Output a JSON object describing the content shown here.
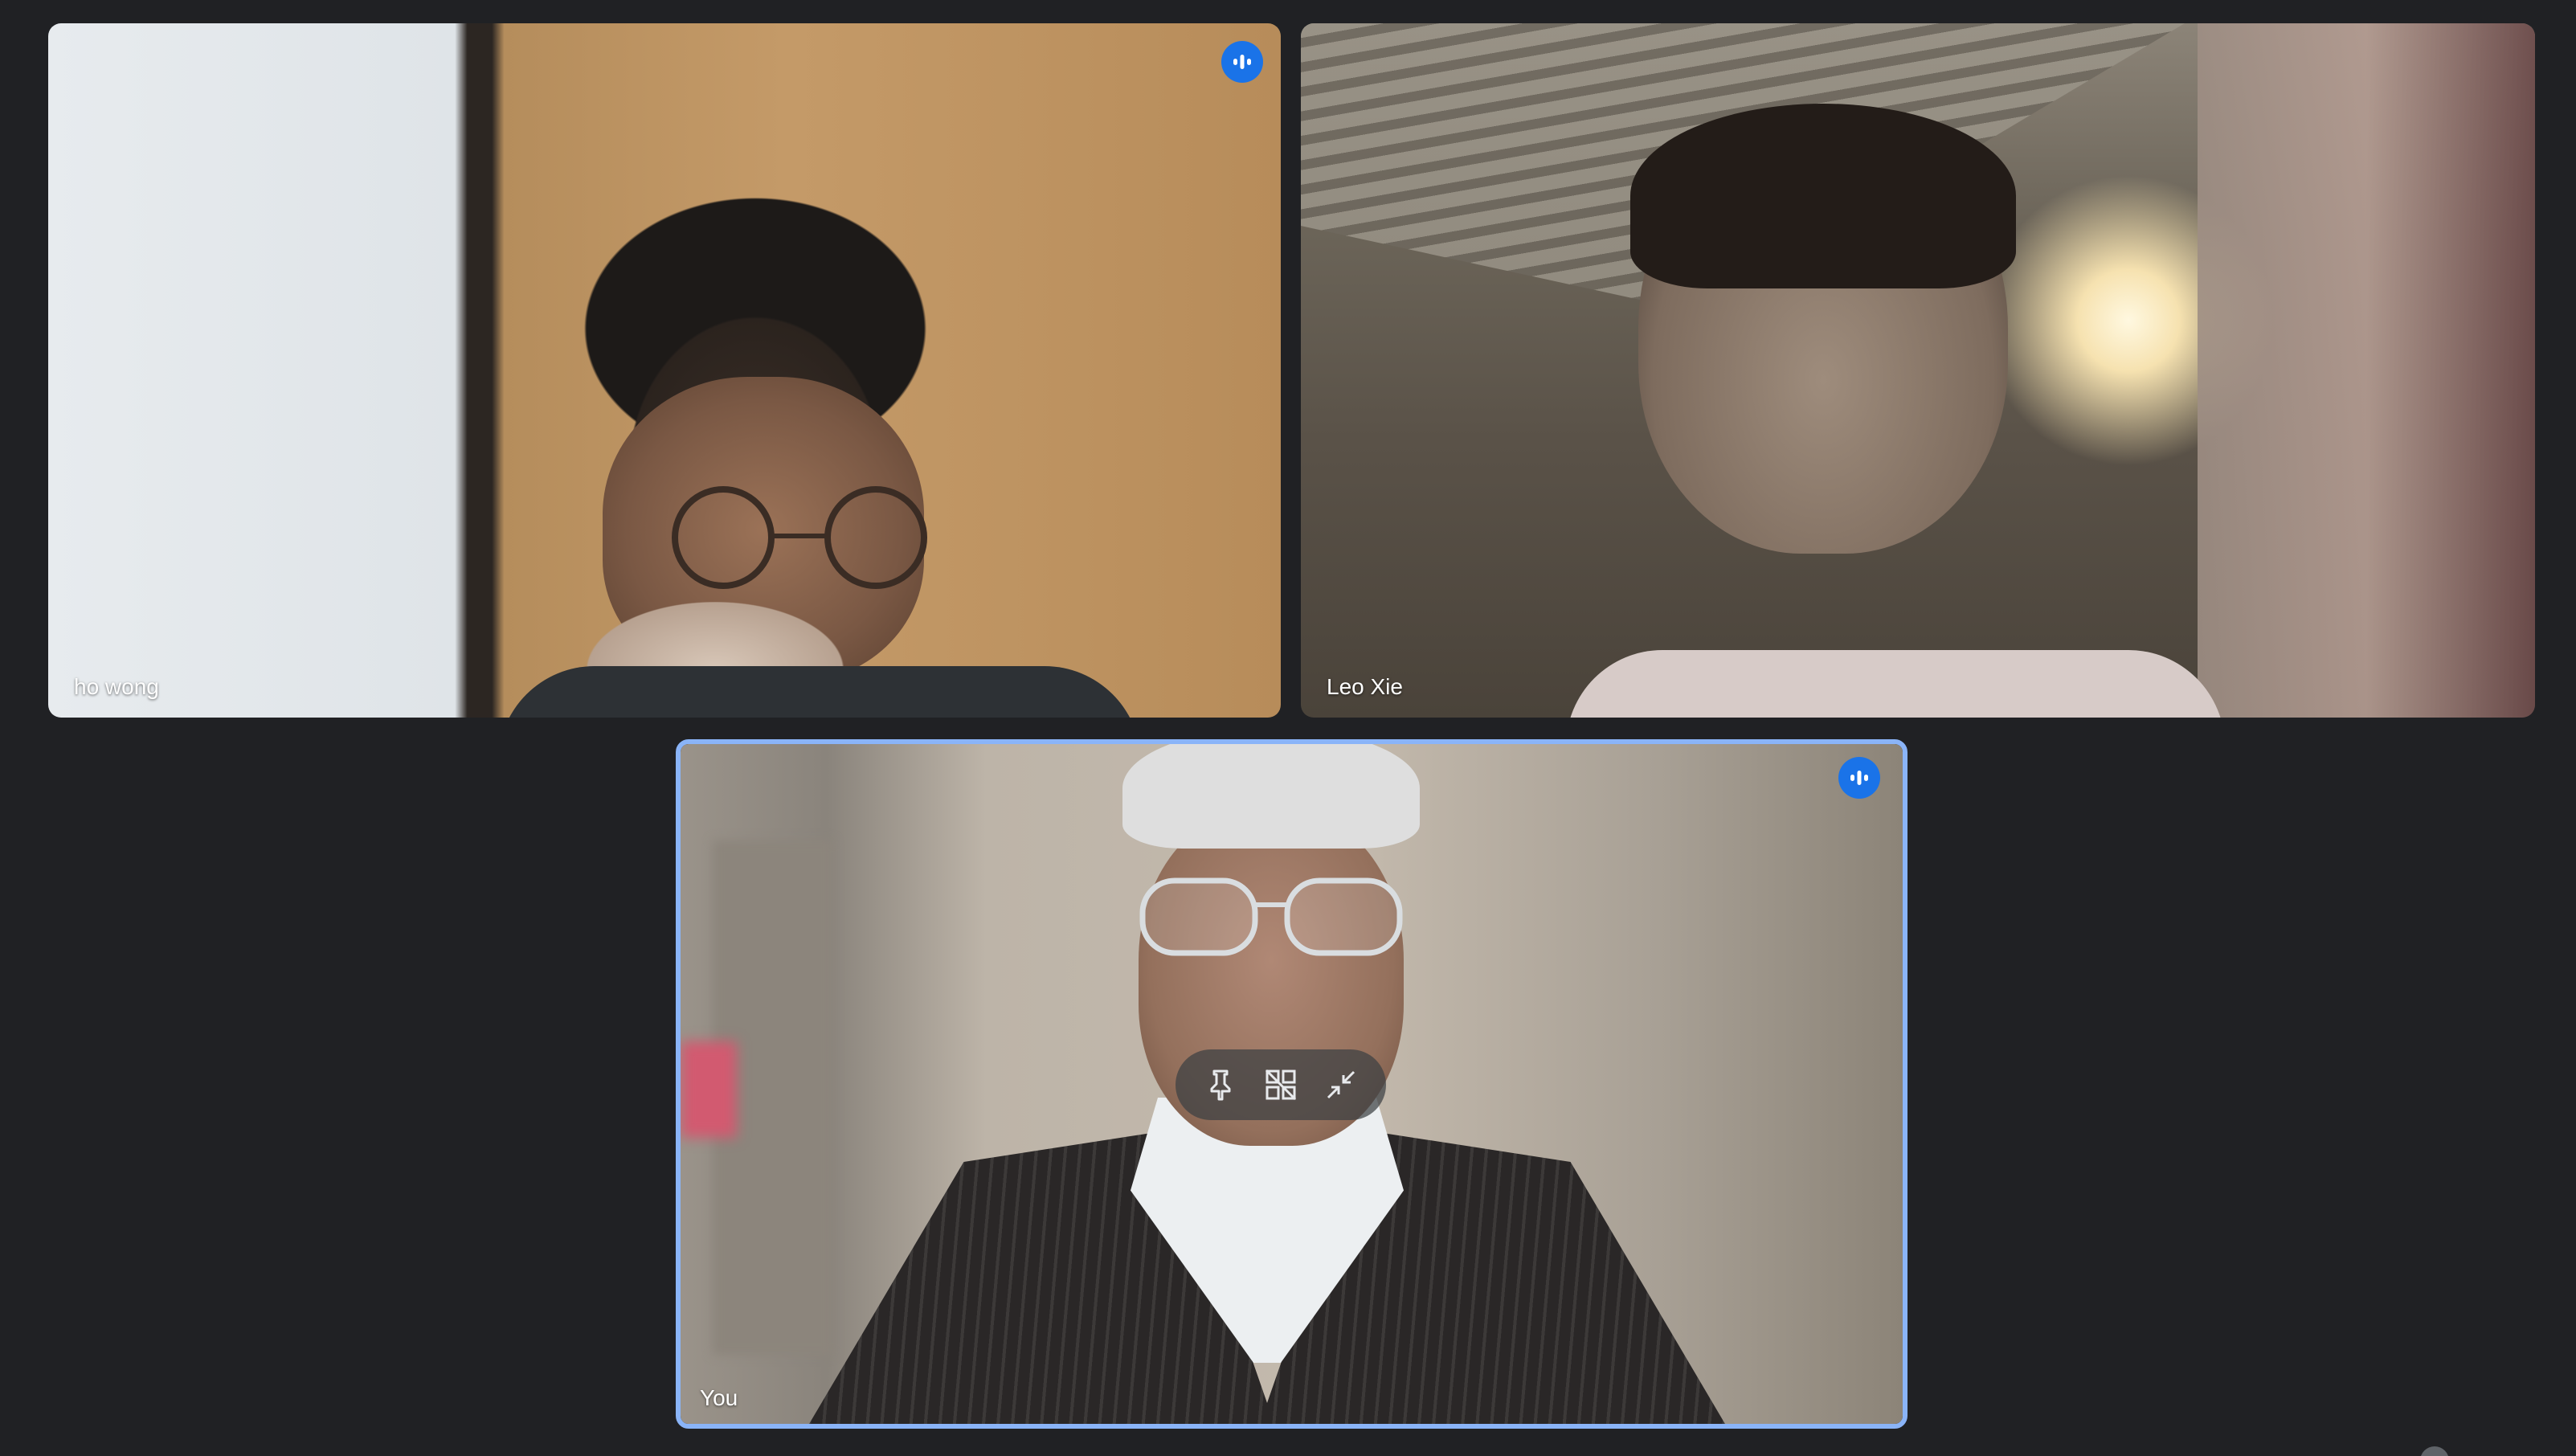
{
  "participants": [
    {
      "name": "ho wong",
      "speaking": true
    },
    {
      "name": "Leo Xie",
      "speaking": false
    },
    {
      "name": "You",
      "speaking": true,
      "active_speaker": true
    }
  ],
  "tile_controls": {
    "pin_icon": "pin-icon",
    "remove_icon": "remove-from-grid-icon",
    "minimize_icon": "minimize-icon"
  },
  "colors": {
    "background": "#202124",
    "active_border": "#8ab4f8",
    "speaking_badge": "#1a73e8"
  }
}
